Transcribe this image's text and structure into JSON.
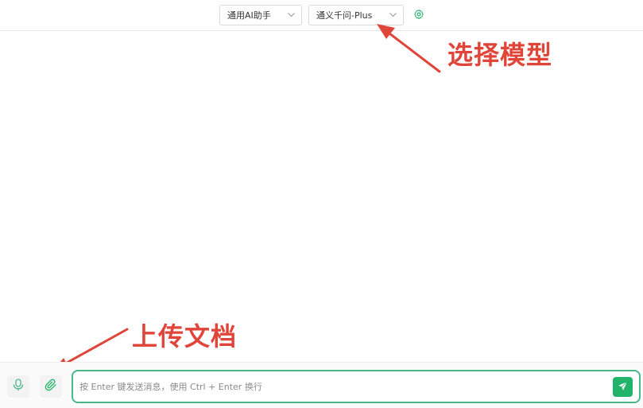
{
  "header": {
    "assistant_select": {
      "value": "通用AI助手"
    },
    "model_select": {
      "value": "通义千问-Plus"
    },
    "settings_icon": "gear-icon"
  },
  "annotations": {
    "select_model": "选择模型",
    "upload_doc": "上传文档"
  },
  "input_bar": {
    "placeholder": "按 Enter 键发送消息，使用 Ctrl + Enter 换行",
    "value": "",
    "mic_icon": "microphone-icon",
    "attach_icon": "paperclip-icon",
    "send_icon": "send-icon"
  },
  "colors": {
    "accent": "#21b36a",
    "input_border": "#48b889",
    "annotation_red": "#e0453a"
  }
}
